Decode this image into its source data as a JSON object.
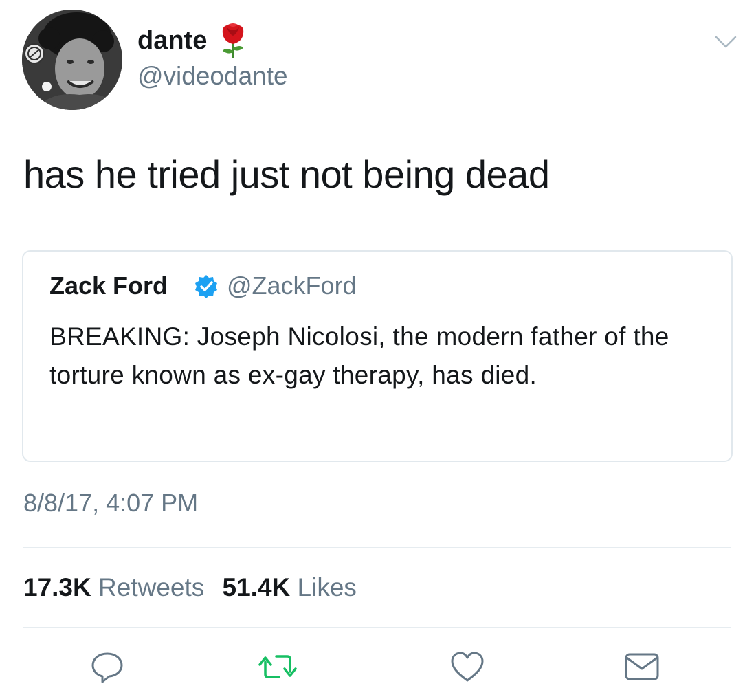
{
  "tweet": {
    "author": {
      "display_name": "dante",
      "name_emoji": "rose-icon",
      "handle": "@videodante",
      "avatar": "avatar"
    },
    "menu_icon": "chevron-down-icon",
    "text": "has he tried just not being dead",
    "quoted_tweet": {
      "author_name": "Zack Ford",
      "verified_icon": "verified-badge-icon",
      "author_handle": "@ZackFord",
      "text": "BREAKING: Joseph Nicolosi, the modern father of the torture known as ex-gay therapy, has died."
    },
    "timestamp": "8/8/17, 4:07 PM",
    "stats": {
      "retweets_count": "17.3K",
      "retweets_label": "Retweets",
      "likes_count": "51.4K",
      "likes_label": "Likes"
    },
    "actions": [
      "reply-icon",
      "retweet-icon",
      "like-icon",
      "direct-message-icon"
    ]
  },
  "colors": {
    "text_primary": "#14171a",
    "text_secondary": "#657786",
    "verified_blue": "#1da1f2",
    "retweet_green": "#17bf63",
    "border": "#e1e8ed"
  }
}
